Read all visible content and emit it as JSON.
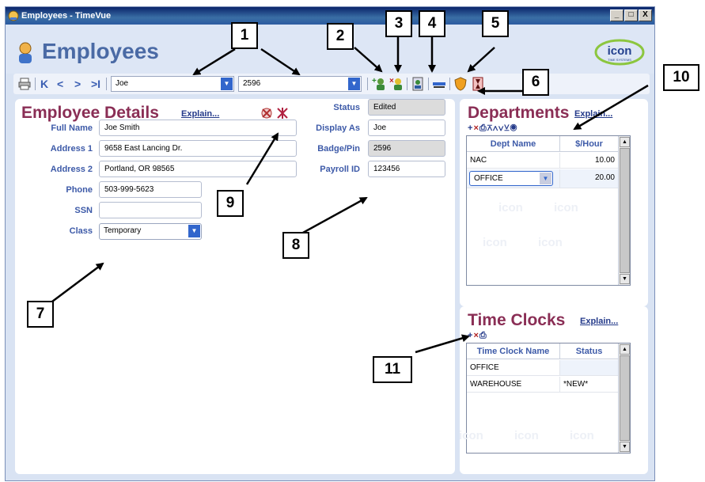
{
  "window": {
    "title": "Employees - TimeVue",
    "minimize": "_",
    "maximize": "□",
    "close": "X"
  },
  "header": {
    "title": "Employees"
  },
  "logo": {
    "text": "icon",
    "subtext": "TIME SYSTEMS"
  },
  "toolbar": {
    "nav": {
      "first": "K",
      "prev": "<",
      "next": ">",
      "last": ">I"
    },
    "name_select": "Joe",
    "badge_select": "2596"
  },
  "employee": {
    "title": "Employee Details",
    "explain": "Explain...",
    "full_name_label": "Full Name",
    "full_name": "Joe Smith",
    "address1_label": "Address 1",
    "address1": "9658 East Lancing Dr.",
    "address2_label": "Address 2",
    "address2": "Portland, OR  98565",
    "phone_label": "Phone",
    "phone": "503-999-5623",
    "ssn_label": "SSN",
    "ssn": "",
    "class_label": "Class",
    "class": "Temporary",
    "status_label": "Status",
    "status": "Edited",
    "display_as_label": "Display As",
    "display_as": "Joe",
    "badge_label": "Badge/Pin",
    "badge": "2596",
    "payroll_label": "Payroll ID",
    "payroll": "123456"
  },
  "departments": {
    "title": "Departments",
    "explain": "Explain...",
    "headers": [
      "Dept Name",
      "$/Hour"
    ],
    "rows": [
      {
        "name": "NAC",
        "rate": "10.00"
      },
      {
        "name": "OFFICE",
        "rate": "20.00"
      }
    ]
  },
  "timeclocks": {
    "title": "Time Clocks",
    "explain": "Explain...",
    "headers": [
      "Time Clock Name",
      "Status"
    ],
    "rows": [
      {
        "name": "OFFICE",
        "status": ""
      },
      {
        "name": "WAREHOUSE",
        "status": "*NEW*"
      }
    ]
  },
  "watermark": "icon",
  "callouts": [
    "1",
    "2",
    "3",
    "4",
    "5",
    "6",
    "7",
    "8",
    "9",
    "10",
    "11"
  ],
  "colors": {
    "accent": "#3266cc",
    "section_title": "#8a2e55",
    "label": "#3d5aa8",
    "header_title": "#4a6aa5"
  }
}
